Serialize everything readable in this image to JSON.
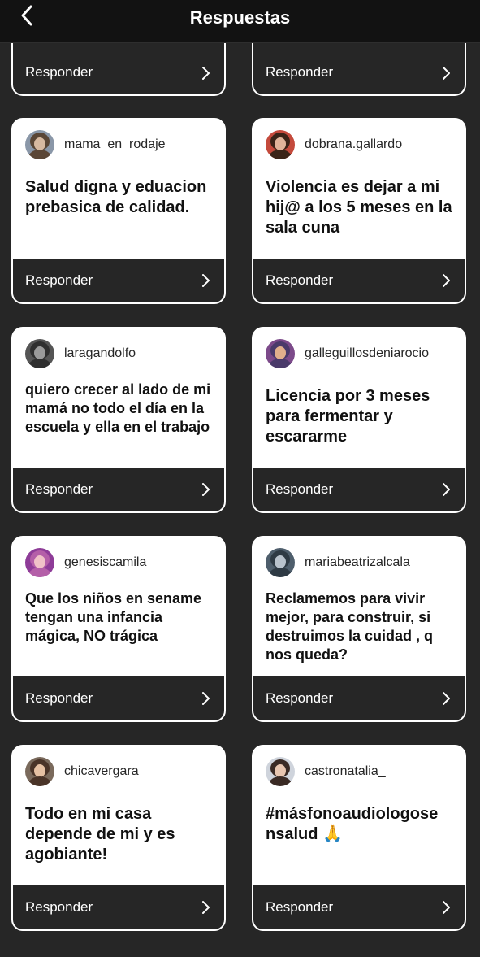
{
  "header": {
    "title": "Respuestas",
    "back_icon": "chevron-left-icon"
  },
  "reply_label": "Responder",
  "partial_cards": [
    {
      "reply": "Responder"
    },
    {
      "reply": "Responder"
    }
  ],
  "cards": [
    {
      "username": "mama_en_rodaje",
      "text": "Salud digna  y eduacion prebasica de calidad.",
      "avatar_colors": [
        "#5a4636",
        "#d7b9a0",
        "#8a97a8"
      ]
    },
    {
      "username": "dobrana.gallardo",
      "text": "Violencia es dejar a mi hij@ a los 5 meses en la sala cuna",
      "avatar_colors": [
        "#3b2418",
        "#e0b49a",
        "#c44a3c"
      ]
    },
    {
      "username": "laragandolfo",
      "text": "quiero crecer al lado de mi mamá  no todo el día en la escuela y ella en el trabajo",
      "avatar_colors": [
        "#2f2f2f",
        "#9a9a9a",
        "#555555"
      ]
    },
    {
      "username": "galleguillosdeniarocio",
      "text": "Licencia por 3 meses para fermentar y escararme",
      "avatar_colors": [
        "#4a3a6a",
        "#e2b08c",
        "#7c4a8a"
      ]
    },
    {
      "username": "genesiscamila",
      "text": "Que los niños en sename tengan una infancia mágica, NO trágica",
      "avatar_colors": [
        "#b45fa8",
        "#f0c2c8",
        "#8e3c98"
      ]
    },
    {
      "username": "mariabeatrizalcala",
      "text": "Reclamemos para vivir mejor, para construir, si destruimos la cuidad , q nos queda?",
      "avatar_colors": [
        "#2e3a44",
        "#b8c2cc",
        "#4e5e6c"
      ]
    },
    {
      "username": "chicavergara",
      "text": "Todo en mi casa depende de mi y es agobiante!",
      "avatar_colors": [
        "#4a3428",
        "#e6c1a3",
        "#7a6a5c"
      ]
    },
    {
      "username": "castronatalia_",
      "text": "#másfonoaudiologose nsalud 🙏",
      "avatar_colors": [
        "#3a2a24",
        "#e8c6b0",
        "#cfd4dc"
      ]
    }
  ]
}
